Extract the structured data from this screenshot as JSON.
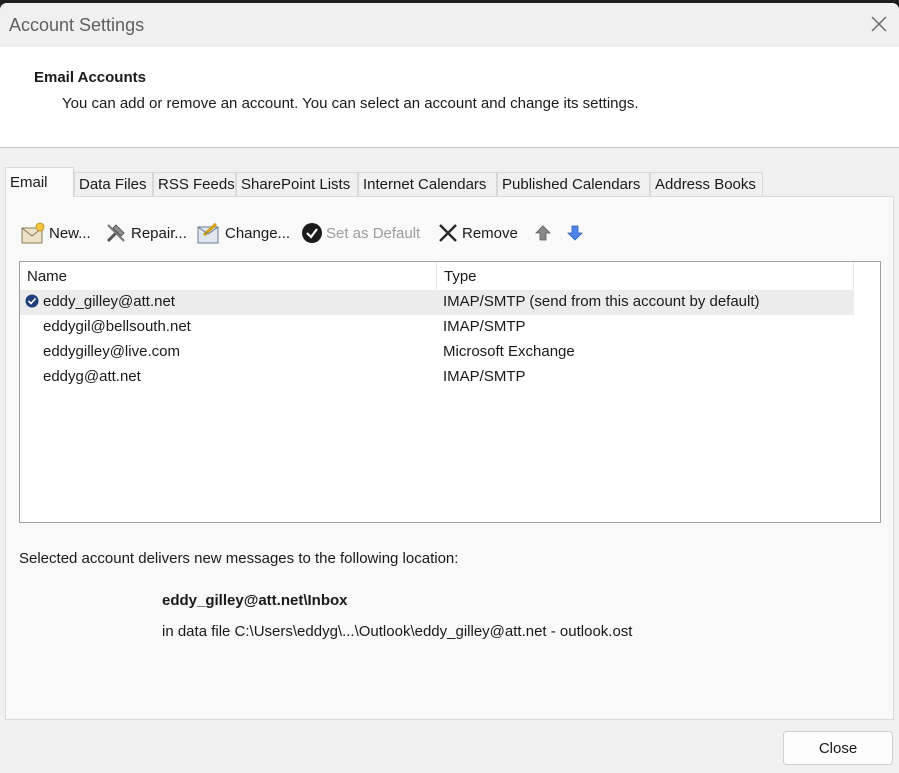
{
  "window": {
    "title": "Account Settings"
  },
  "header": {
    "title": "Email Accounts",
    "description": "You can add or remove an account. You can select an account and change its settings."
  },
  "tabs": [
    {
      "label": "Email",
      "active": true
    },
    {
      "label": "Data Files"
    },
    {
      "label": "RSS Feeds"
    },
    {
      "label": "SharePoint Lists"
    },
    {
      "label": "Internet Calendars"
    },
    {
      "label": "Published Calendars"
    },
    {
      "label": "Address Books"
    }
  ],
  "toolbar": {
    "new_label": "New...",
    "repair_label": "Repair...",
    "change_label": "Change...",
    "set_default_label": "Set as Default",
    "remove_label": "Remove"
  },
  "accounts": {
    "columns": {
      "name": "Name",
      "type": "Type"
    },
    "rows": [
      {
        "name": "eddy_gilley@att.net",
        "type": "IMAP/SMTP (send from this account by default)",
        "default": true,
        "selected": true
      },
      {
        "name": "eddygil@bellsouth.net",
        "type": "IMAP/SMTP"
      },
      {
        "name": "eddygilley@live.com",
        "type": "Microsoft Exchange"
      },
      {
        "name": "eddyg@att.net",
        "type": "IMAP/SMTP"
      }
    ]
  },
  "delivery": {
    "label": "Selected account delivers new messages to the following location:",
    "folder": "eddy_gilley@att.net\\Inbox",
    "file": "in data file C:\\Users\\eddyg\\...\\Outlook\\eddy_gilley@att.net - outlook.ost"
  },
  "footer": {
    "close_label": "Close"
  },
  "colors": {
    "accent_blue": "#2b6fd6",
    "default_check": "#1f3f7a"
  }
}
